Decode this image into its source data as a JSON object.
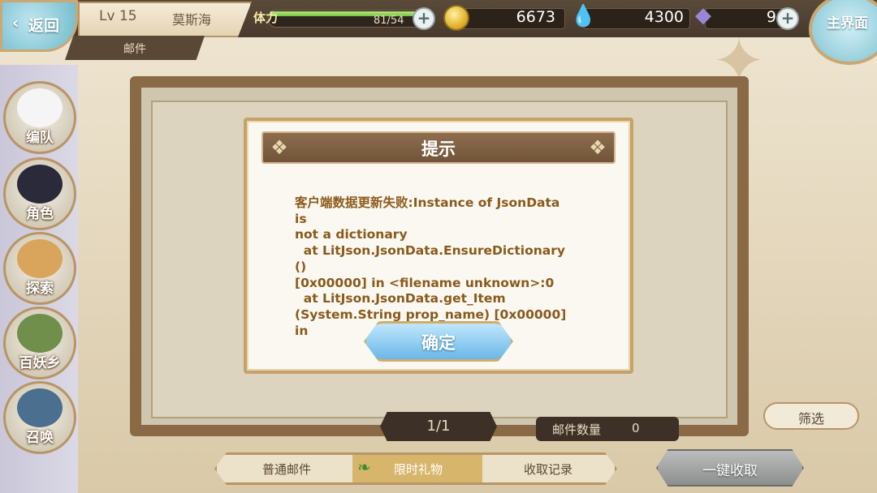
{
  "header": {
    "back_label": "返回",
    "level_label": "Lv 15",
    "player_name": "莫斯海",
    "stamina_label": "体力",
    "stamina_value": "81/54",
    "stamina_fill": 1.0,
    "gold": "6673",
    "gems": "4300",
    "crystals": "9",
    "home_label": "主界面",
    "section_tab": "邮件"
  },
  "sidebar": {
    "items": [
      {
        "label": "编队",
        "icon": "team-icon"
      },
      {
        "label": "角色",
        "icon": "character-icon"
      },
      {
        "label": "探索",
        "icon": "explore-icon"
      },
      {
        "label": "百妖乡",
        "icon": "village-icon"
      },
      {
        "label": "召唤",
        "icon": "summon-icon"
      }
    ]
  },
  "dialog": {
    "title": "提示",
    "message": "客户端数据更新失败:Instance of JsonData is\nnot a dictionary\n  at LitJson.JsonData.EnsureDictionary ()\n[0x00000] in <filename unknown>:0\n  at LitJson.JsonData.get_Item\n(System.String prop_name) [0x00000] in",
    "confirm_label": "确定"
  },
  "mail": {
    "pager": "1/1",
    "count_label": "邮件数量",
    "count_value": "0",
    "filter_label": "筛选"
  },
  "tabs": [
    {
      "label": "普通邮件",
      "active": false
    },
    {
      "label": "限时礼物",
      "active": true
    },
    {
      "label": "收取记录",
      "active": false
    }
  ],
  "claim_all_label": "一键收取",
  "colors": {
    "dialog_text": "#8a5a1c",
    "frame": "#8a6a46",
    "button_blue": "#6bb7e8"
  }
}
